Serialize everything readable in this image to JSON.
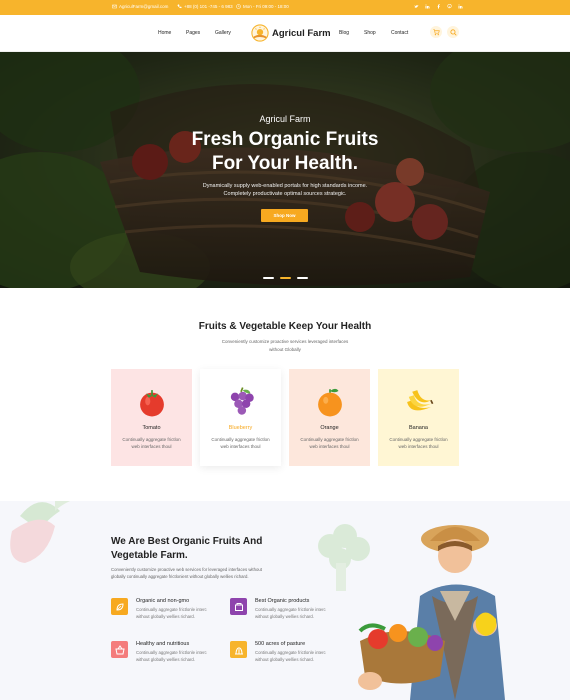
{
  "topbar": {
    "email": "AgriculFarm@gmail.com",
    "phone": "+88 (0) 101 -745 - 6 983",
    "hours": "Mon - Fri 09:00 - 18:00"
  },
  "header": {
    "nav_left": [
      "Home",
      "Pages",
      "Gallery"
    ],
    "logo_text": "Agricul Farm",
    "nav_right": [
      "Blog",
      "Shop",
      "Contact"
    ]
  },
  "hero": {
    "kicker": "Agricul Farm",
    "title_line1": "Fresh Organic Fruits",
    "title_line2": "For Your Health.",
    "sub_line1": "Dynamically supply web-enabled portals for high standards income.",
    "sub_line2": "Completely productivate optimal sources strategic.",
    "button_label": "Shop Now",
    "slides": 3,
    "active_slide": 2
  },
  "fruits": {
    "title": "Fruits & Vegetable Keep Your Health",
    "subtitle_line1": "Conveniently customize proactive services leveraged interfaces",
    "subtitle_line2": "without Globally",
    "cards": [
      {
        "name": "Tomato",
        "desc1": "Continually aggregate frictlon",
        "desc2": "web interfaces thoul",
        "bg": "#fde4e4",
        "name_color": "#222222"
      },
      {
        "name": "Blueberry",
        "desc1": "Continually aggregate frictlon",
        "desc2": "web interfaces thoul",
        "bg": "#ffffff",
        "name_color": "#f7a920"
      },
      {
        "name": "Orange",
        "desc1": "Continually aggregate frictlon",
        "desc2": "web interfaces thoul",
        "bg": "#fde7dc",
        "name_color": "#222222"
      },
      {
        "name": "Banana",
        "desc1": "Continually aggregate frictlon",
        "desc2": "web interfaces thoul",
        "bg": "#fff6d4",
        "name_color": "#222222"
      }
    ]
  },
  "about": {
    "title_line1": "We Are Best Organic Fruits And",
    "title_line2": "Vegetable Farm.",
    "desc_line1": "Conveniently customize proactive web services for leveraged interfaces without",
    "desc_line2": "globally continually aggregate frictlonient without globally wellies richard.",
    "features": [
      {
        "title": "Organic and non-gmo",
        "desc1": "Continually aggregate frictlonle interc",
        "desc2": "without globally wellies richard.",
        "color": "#f7a920",
        "icon": "leaf-box-icon"
      },
      {
        "title": "Best Organic products",
        "desc1": "Continually aggregate frictlonle interc",
        "desc2": "without globally wellies richard.",
        "color": "#8e44ad",
        "icon": "product-box-icon"
      },
      {
        "title": "Healthy and nutritious",
        "desc1": "Continually aggregate frictlonle interc",
        "desc2": "without globally wellies richard.",
        "color": "#f47c7c",
        "icon": "basket-icon"
      },
      {
        "title": "500 acres of pasture",
        "desc1": "Continually aggregate frictlonle interc",
        "desc2": "without globally wellies richard.",
        "color": "#f7b42c",
        "icon": "pasture-icon"
      }
    ]
  },
  "colors": {
    "accent": "#f7b42c",
    "button": "#f7a920"
  }
}
